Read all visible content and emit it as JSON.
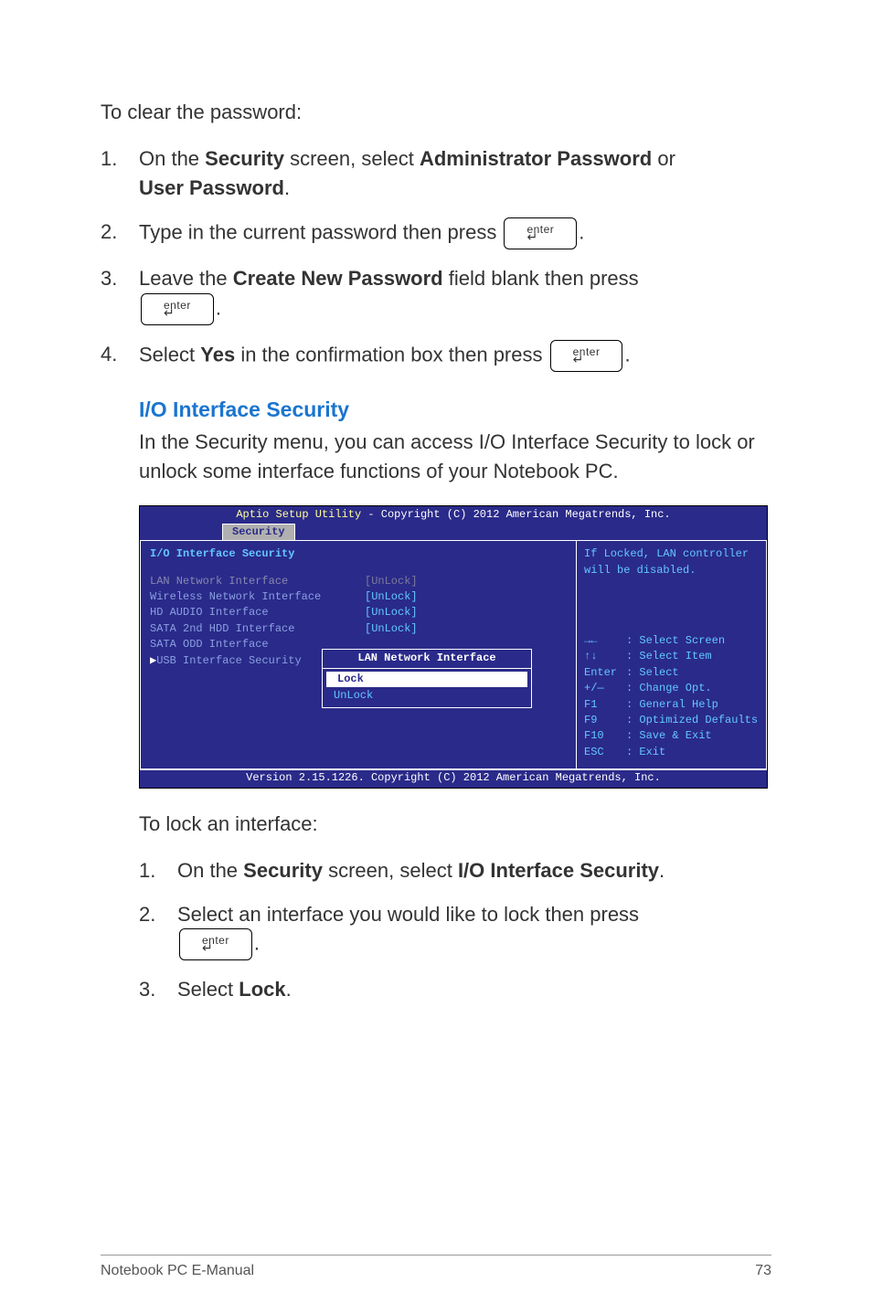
{
  "lead1": "To clear the password:",
  "clear_steps": [
    {
      "num": "1.",
      "pre": "On the ",
      "b1": "Security",
      "mid": " screen, select ",
      "b2": "Administrator Password",
      "post": " or ",
      "b3": "User Password",
      "tail": "."
    },
    {
      "num": "2.",
      "pre": "Type in the current password then press ",
      "k": true,
      "post": "."
    },
    {
      "num": "3.",
      "pre": "Leave the ",
      "b1": "Create New Password",
      "mid": " field blank then press ",
      "k": true,
      "post": "."
    },
    {
      "num": "4.",
      "pre": "Select ",
      "b1": "Yes",
      "mid": " in the confirmation box then press ",
      "k": true,
      "post": "."
    }
  ],
  "section_title": "I/O Interface Security",
  "section_text": "In the Security menu, you can access I/O Interface Security to lock or unlock some interface functions of your Notebook PC.",
  "lead2": "To lock an interface:",
  "lock_steps": [
    {
      "num": "1.",
      "pre": "On the ",
      "b1": "Security",
      "mid": " screen, select ",
      "b2": "I/O Interface Security",
      "post": "."
    },
    {
      "num": "2.",
      "pre": "Select an interface you would like to lock then press ",
      "k": true,
      "post": "."
    },
    {
      "num": "3.",
      "pre": "Select ",
      "b1": "Lock",
      "post": "."
    }
  ],
  "bios": {
    "header_pre": "Aptio Setup Utility",
    "header_post": " - Copyright (C) 2012 American Megatrends, Inc.",
    "tab": "Security",
    "main_title": "I/O Interface Security",
    "rows": [
      {
        "label": "LAN Network Interface",
        "value": "[UnLock]",
        "grey": true
      },
      {
        "label": "Wireless Network Interface",
        "value": "[UnLock]"
      },
      {
        "label": "HD AUDIO Interface",
        "value": "[UnLock]"
      },
      {
        "label": "SATA 2nd HDD Interface",
        "value": "[UnLock]"
      },
      {
        "label": "SATA ODD Interface",
        "value": ""
      },
      {
        "label": "USB Interface Security",
        "value": "",
        "pointer": true
      }
    ],
    "popup_title": "LAN Network Interface",
    "popup_items": [
      "Lock",
      "UnLock"
    ],
    "hint_top": "If Locked, LAN controller will be disabled.",
    "hints": [
      {
        "k": "→←",
        "v": ": Select Screen"
      },
      {
        "k": "↑↓",
        "v": ": Select Item"
      },
      {
        "k": "Enter",
        "v": ": Select",
        "nocolon": true
      },
      {
        "k": "+/—",
        "v": ": Change Opt."
      },
      {
        "k": "F1",
        "v": ": General Help"
      },
      {
        "k": "F9",
        "v": ": Optimized Defaults"
      },
      {
        "k": "F10",
        "v": ": Save & Exit"
      },
      {
        "k": "ESC",
        "v": ": Exit"
      }
    ],
    "footer": "Version 2.15.1226. Copyright (C) 2012 American Megatrends, Inc."
  },
  "enter_label": "enter",
  "footer_left": "Notebook PC E-Manual",
  "footer_right": "73"
}
